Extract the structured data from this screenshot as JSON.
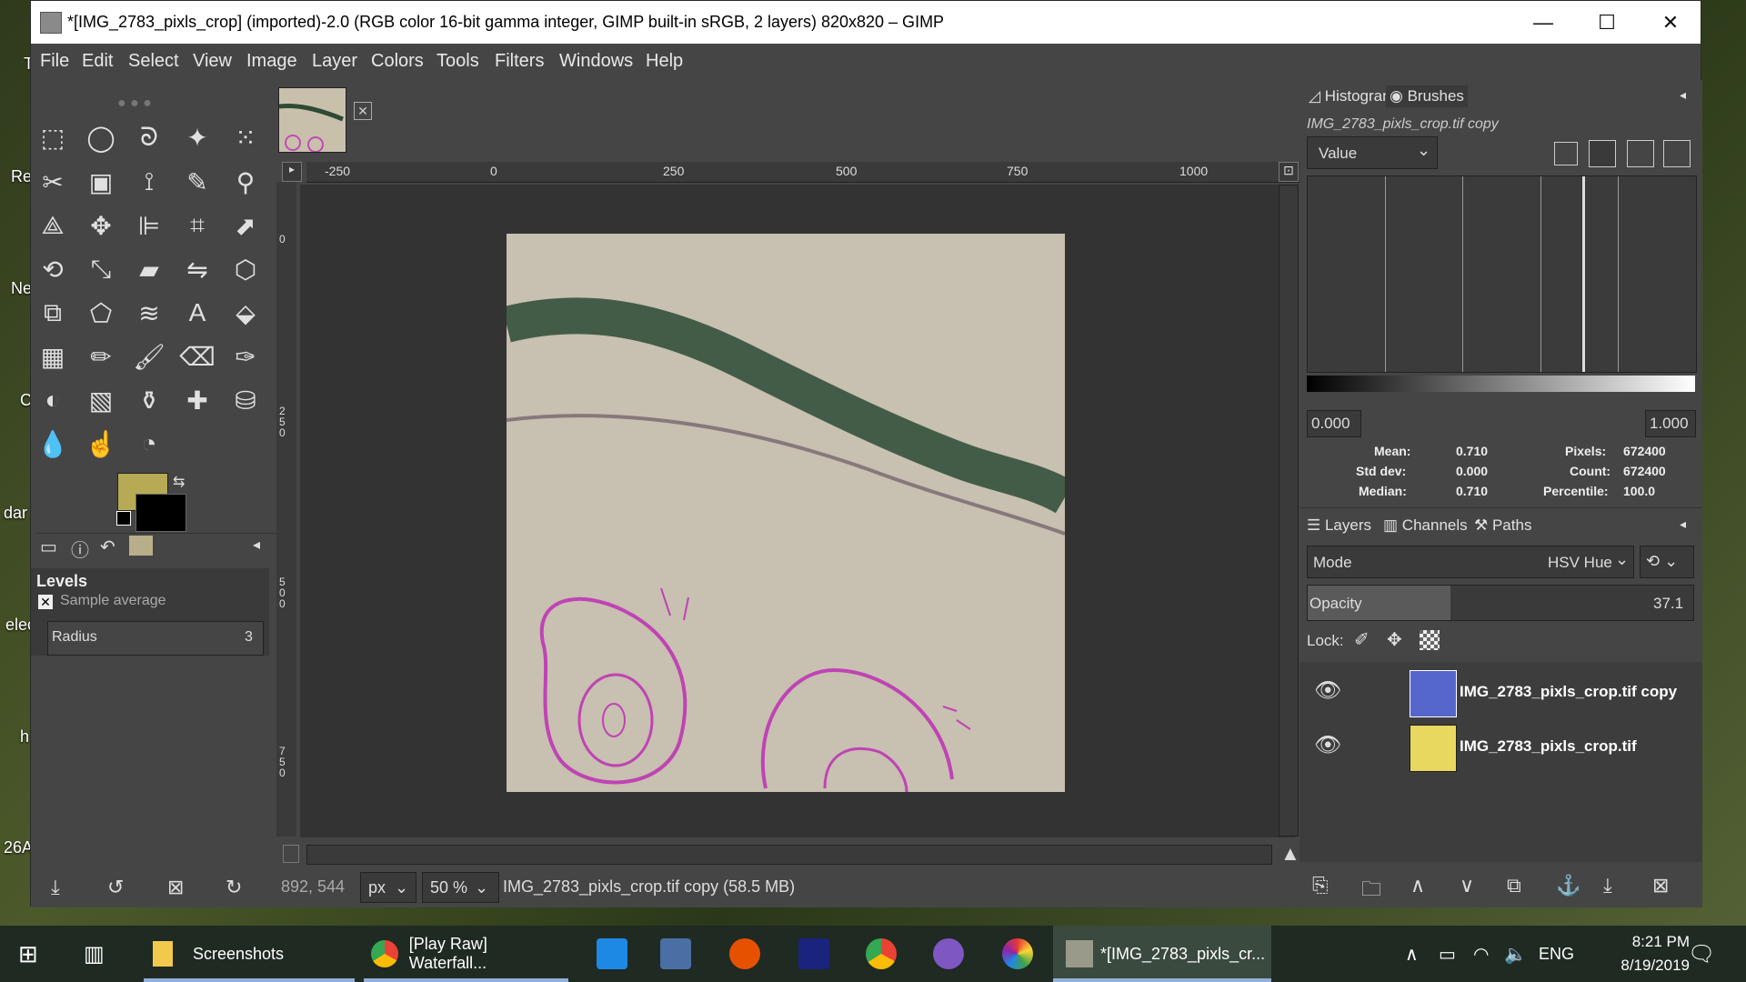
{
  "desktop": {
    "labels": [
      "T",
      "Re",
      "Ne",
      "C",
      "dar",
      "elec",
      "h",
      "26A"
    ]
  },
  "window": {
    "title": "*[IMG_2783_pixls_crop] (imported)-2.0 (RGB color 16-bit gamma integer, GIMP built-in sRGB, 2 layers) 820x820 – GIMP",
    "minimize": "—",
    "maximize": "☐",
    "close": "✕"
  },
  "menu": [
    "File",
    "Edit",
    "Select",
    "View",
    "Image",
    "Layer",
    "Colors",
    "Tools",
    "Filters",
    "Windows",
    "Help"
  ],
  "colors": {
    "foreground": "#b6aa55",
    "background": "#000000"
  },
  "tool_options": {
    "title": "Levels",
    "sample_average_label": "Sample average",
    "radius_label": "Radius",
    "radius_value": "3"
  },
  "ruler": {
    "h_ticks": [
      "-250",
      "0",
      "250",
      "500",
      "750",
      "1000"
    ],
    "v_ticks": [
      "0",
      "250",
      "500",
      "750"
    ]
  },
  "status": {
    "coords": "892, 544",
    "unit": "px",
    "zoom": "50 %",
    "info": "IMG_2783_pixls_crop.tif copy (58.5 MB)"
  },
  "histogram": {
    "tab1": "Histogram",
    "tab2": "Brushes",
    "drawable": "IMG_2783_pixls_crop.tif copy",
    "channel": "Value",
    "range_min": "0.000",
    "range_max": "1.000",
    "mean_label": "Mean:",
    "mean": "0.710",
    "std_label": "Std dev:",
    "std": "0.000",
    "median_label": "Median:",
    "median": "0.710",
    "pixels_label": "Pixels:",
    "pixels": "672400",
    "count_label": "Count:",
    "count": "672400",
    "percentile_label": "Percentile:",
    "percentile": "100.0"
  },
  "layers_panel": {
    "tab1": "Layers",
    "tab2": "Channels",
    "tab3": "Paths",
    "mode_label": "Mode",
    "mode_value": "HSV Hue",
    "opacity_label": "Opacity",
    "opacity_value": "37.1",
    "lock_label": "Lock:",
    "layers": [
      {
        "name": "IMG_2783_pixls_crop.tif copy",
        "thumb": "#5566cc"
      },
      {
        "name": "IMG_2783_pixls_crop.tif",
        "thumb": "#e8d860"
      }
    ]
  },
  "taskbar": {
    "screenshots": "Screenshots",
    "chrome": "[Play Raw] Waterfall...",
    "gimp": "*[IMG_2783_pixls_cr...",
    "lang": "ENG",
    "time": "8:21 PM",
    "date": "8/19/2019"
  }
}
